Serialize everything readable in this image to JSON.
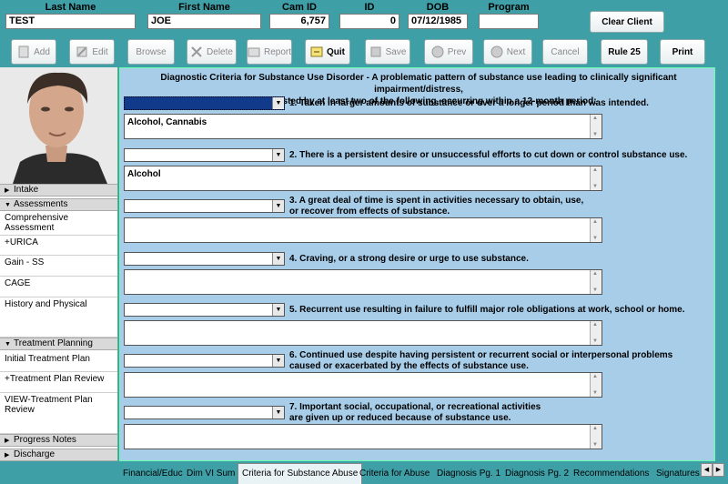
{
  "header": {
    "labels": {
      "last_name": "Last Name",
      "first_name": "First Name",
      "cam_id": "Cam ID",
      "id": "ID",
      "dob": "DOB",
      "program": "Program"
    },
    "values": {
      "last_name": "TEST",
      "first_name": "JOE",
      "cam_id": "6,757",
      "id": "0",
      "dob": "07/12/1985",
      "program": ""
    },
    "clear_client": "Clear Client"
  },
  "toolbar": {
    "add": "Add",
    "edit": "Edit",
    "browse": "Browse",
    "delete": "Delete",
    "report": "Report",
    "quit": "Quit",
    "save": "Save",
    "prev": "Prev",
    "next": "Next",
    "cancel": "Cancel",
    "rule25": "Rule 25",
    "print": "Print"
  },
  "sidebar": {
    "intake": "Intake",
    "assessments": "Assessments",
    "assessment_items": [
      "Comprehensive Assessment",
      "+URICA",
      "Gain - SS",
      "CAGE",
      "History and Physical"
    ],
    "treatment_planning": "Treatment Planning",
    "treatment_items": [
      "Initial Treatment Plan",
      "+Treatment Plan Review",
      "VIEW-Treatment Plan Review"
    ],
    "progress_notes": "Progress Notes",
    "discharge": "Discharge"
  },
  "main": {
    "description_line1": "Diagnostic Criteria for Substance Use Disorder - A problematic pattern of substance use leading to clinically significant impairment/distress,",
    "description_line2": "as manifested by at least two of the following, occurring within a 12-month period:",
    "criteria": [
      {
        "line1": "1. Taken in larger amounts of substance or over a longer period than was intended.",
        "line2": "",
        "note": "Alcohol, Cannabis"
      },
      {
        "line1": "2. There is a persistent desire or unsuccessful efforts to cut down or control substance use.",
        "line2": "",
        "note": "Alcohol"
      },
      {
        "line1": "3. A great deal of time is spent in activities necessary to obtain, use,",
        "line2": "or recover from effects of substance.",
        "note": ""
      },
      {
        "line1": "4. Craving, or a strong desire or urge to use substance.",
        "line2": "",
        "note": ""
      },
      {
        "line1": "5. Recurrent use resulting in failure to fulfill major role obligations at work, school or home.",
        "line2": "",
        "note": ""
      },
      {
        "line1": "6. Continued use despite having persistent or recurrent social or interpersonal problems",
        "line2": "caused or exacerbated by the effects of substance use.",
        "note": ""
      },
      {
        "line1": "7. Important social, occupational, or recreational activities",
        "line2": "are given up or reduced because of substance use.",
        "note": ""
      }
    ]
  },
  "tabs": [
    "Financial/Educ",
    "Dim VI Sum",
    "Criteria for Substance Abuse",
    "Criteria for Abuse",
    "Diagnosis Pg. 1",
    "Diagnosis Pg. 2",
    "Recommendations",
    "Signatures"
  ],
  "colors": {
    "background": "#3f9fa6",
    "panel": "#a7cde9",
    "selected_dropdown": "#123a8a"
  }
}
